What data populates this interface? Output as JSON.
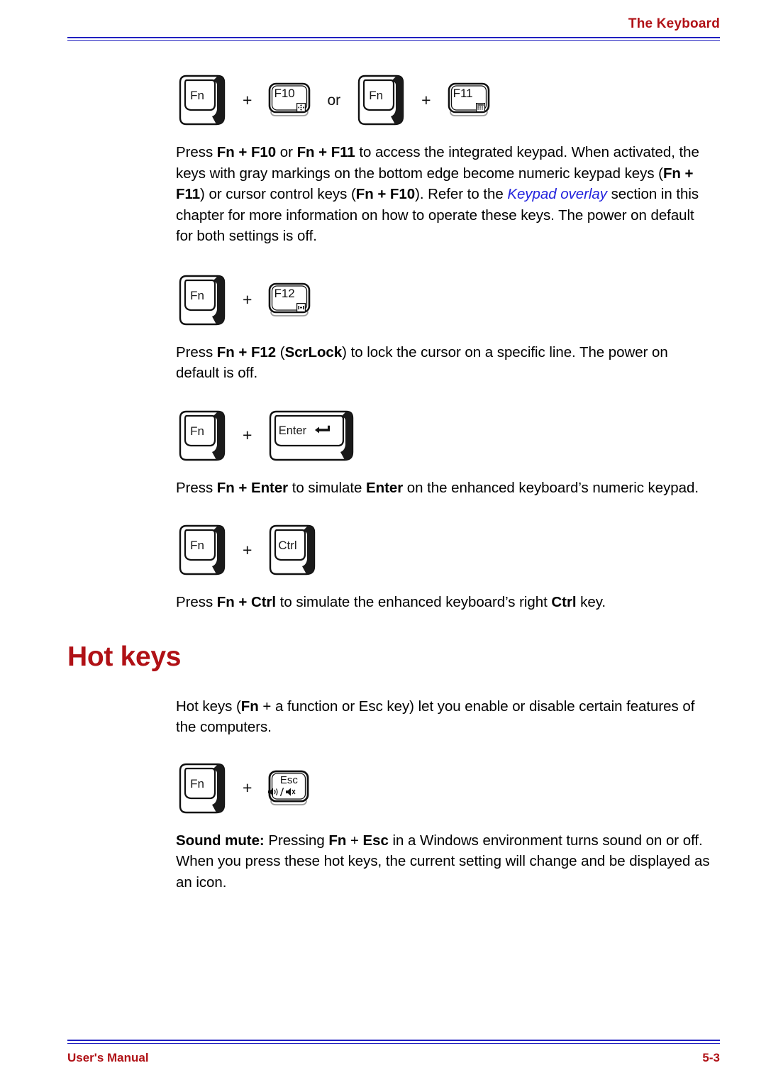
{
  "header": {
    "title": "The Keyboard",
    "rule_color": "#2020c0",
    "title_color": "#b01116"
  },
  "footer": {
    "manual_label": "User's Manual",
    "page_number": "5-3",
    "color": "#b01116"
  },
  "key_rows": [
    {
      "id": "fn-f10-or-fn-f11",
      "items": [
        {
          "type": "key3d",
          "label": "Fn"
        },
        {
          "type": "plus",
          "label": "+"
        },
        {
          "type": "keyflat",
          "label": "F10",
          "badge": "cursor-control-icon"
        },
        {
          "type": "or",
          "label": "or"
        },
        {
          "type": "key3d",
          "label": "Fn"
        },
        {
          "type": "plus",
          "label": "+"
        },
        {
          "type": "keyflat",
          "label": "F11",
          "badge": "numeric-keypad-icon"
        }
      ]
    },
    {
      "id": "fn-f12",
      "items": [
        {
          "type": "key3d",
          "label": "Fn"
        },
        {
          "type": "plus",
          "label": "+"
        },
        {
          "type": "keyflat",
          "label": "F12",
          "badge": "scroll-lock-icon"
        }
      ]
    },
    {
      "id": "fn-enter",
      "items": [
        {
          "type": "key3d",
          "label": "Fn"
        },
        {
          "type": "plus",
          "label": "+"
        },
        {
          "type": "key3d-wide",
          "label": "Enter",
          "glyph": "return-arrow-icon"
        }
      ]
    },
    {
      "id": "fn-ctrl",
      "items": [
        {
          "type": "key3d",
          "label": "Fn"
        },
        {
          "type": "plus",
          "label": "+"
        },
        {
          "type": "key3d",
          "label": "Ctrl"
        }
      ]
    },
    {
      "id": "fn-esc",
      "items": [
        {
          "type": "key3d",
          "label": "Fn"
        },
        {
          "type": "plus",
          "label": "+"
        },
        {
          "type": "keyflat-esc",
          "label": "Esc",
          "badge": "sound-mute-icon"
        }
      ]
    }
  ],
  "paragraphs": {
    "keypad_access": {
      "run1": "Press ",
      "b1": "Fn + F10",
      "run2": " or ",
      "b2": "Fn + F11",
      "run3": " to access the integrated keypad. When activated, the keys with gray markings on the bottom edge become numeric keypad keys (",
      "b3": "Fn + F11",
      "run4": ") or cursor control keys (",
      "b4": "Fn + F10",
      "run5": "). Refer to the ",
      "xref": "Keypad overlay",
      "run6": " section in this chapter for more information on how to operate these keys. The power on default for both settings is off."
    },
    "scrlock": {
      "run1": "Press ",
      "b1": "Fn + F12",
      "run2": " (",
      "b2": "ScrLock",
      "run3": ") to lock the cursor on a specific line. The power on default is off."
    },
    "enter": {
      "run1": "Press ",
      "b1": "Fn + Enter",
      "run2": " to simulate ",
      "b2": "Enter",
      "run3": " on the enhanced keyboard’s numeric keypad."
    },
    "ctrl": {
      "run1": "Press ",
      "b1": "Fn + Ctrl",
      "run2": " to simulate the enhanced keyboard’s right ",
      "b2": "Ctrl",
      "run3": " key."
    },
    "hotkeys_intro": {
      "run1": "Hot keys (",
      "b1": "Fn",
      "run2": " + a function or Esc key) let you enable or disable certain features of the computers."
    },
    "sound_mute": {
      "b1": "Sound mute:",
      "run1": " Pressing ",
      "b2": "Fn",
      "run2": " + ",
      "b3": "Esc",
      "run3": " in a Windows environment turns sound on or off. When you press these hot keys, the current setting will change and be displayed as an icon."
    }
  },
  "headings": {
    "hot_keys": "Hot keys"
  }
}
